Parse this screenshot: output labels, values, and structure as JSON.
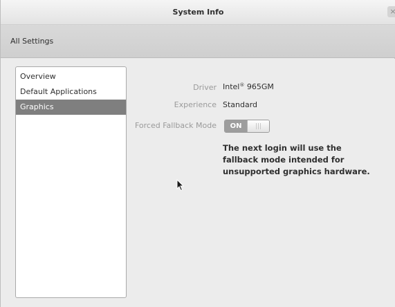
{
  "window": {
    "title": "System Info",
    "close_glyph": "×"
  },
  "toolbar": {
    "all_settings_label": "All Settings"
  },
  "sidebar": {
    "items": [
      {
        "label": "Overview"
      },
      {
        "label": "Default Applications"
      },
      {
        "label": "Graphics"
      }
    ],
    "selected": "Graphics"
  },
  "graphics": {
    "driver_label": "Driver",
    "driver_value_brand": "Intel",
    "driver_value_mark": "®",
    "driver_value_model": " 965GM",
    "experience_label": "Experience",
    "experience_value": "Standard",
    "fallback_label": "Forced Fallback Mode",
    "fallback_toggle_text": "ON",
    "fallback_toggle_state": "on",
    "note": "The next login will use the fallback mode intended for unsupported graphics hardware."
  },
  "icons": {
    "close": "close-icon",
    "cursor": "mouse-pointer-icon"
  }
}
